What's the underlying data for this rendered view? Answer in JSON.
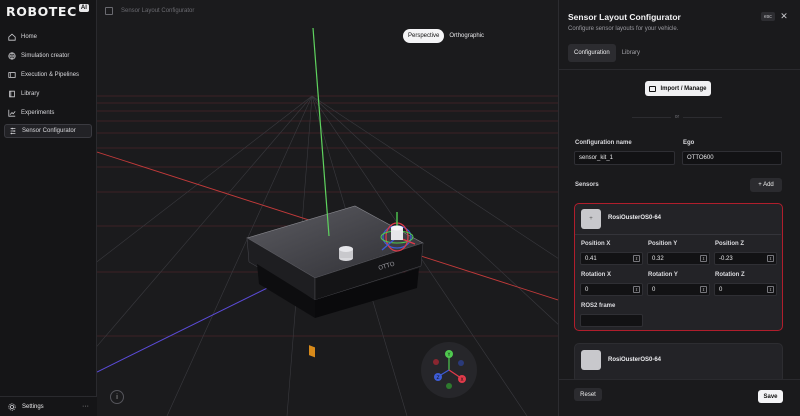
{
  "app": {
    "logo_text": "ROBOTEC",
    "logo_badge": "AI"
  },
  "sidebar": {
    "items": [
      {
        "label": "Home",
        "icon": "home-icon"
      },
      {
        "label": "Simulation creator",
        "icon": "globe-icon"
      },
      {
        "label": "Execution & Pipelines",
        "icon": "layers-icon"
      },
      {
        "label": "Library",
        "icon": "book-icon"
      },
      {
        "label": "Experiments",
        "icon": "chart-icon"
      },
      {
        "label": "Sensor Configurator",
        "icon": "",
        "active": true
      }
    ],
    "settings_label": "Settings",
    "settings_more": "···"
  },
  "viewport": {
    "title": "Sensor Layout Configurator",
    "view_modes": [
      "Perspective",
      "Orthographic"
    ],
    "active_view": "Perspective",
    "robot_label": "OTTO",
    "gizmo_axes": {
      "y": "Y",
      "x": "X",
      "z": "Z"
    },
    "info_label": "i",
    "colors": {
      "grid_red": "#c23a3a",
      "x_axis": "#e03a4a",
      "y_axis": "#4fc94f",
      "z_axis": "#3d5cd6"
    }
  },
  "panel": {
    "title": "Sensor Layout Configurator",
    "subtitle": "Configure sensor layouts for your vehicle.",
    "esc_label": "esc",
    "close_label": "✕",
    "tabs": [
      "Configuration",
      "Library"
    ],
    "active_tab": "Configuration",
    "import_label": "Import / Manage",
    "or_label": "or",
    "config_name_label": "Configuration name",
    "config_name_value": "sensor_kit_1",
    "ego_label": "Ego",
    "ego_value": "OTTO600",
    "sensors_label": "Sensors",
    "add_label": "+ Add",
    "sensors": [
      {
        "name": "RosiOusterOS0-64",
        "thumb": "+",
        "fields": {
          "pos_x": {
            "label": "Position X",
            "value": "0.41"
          },
          "pos_y": {
            "label": "Position Y",
            "value": "0.32"
          },
          "pos_z": {
            "label": "Position Z",
            "value": "-0.23"
          },
          "rot_x": {
            "label": "Rotation X",
            "value": "0"
          },
          "rot_y": {
            "label": "Rotation Y",
            "value": "0"
          },
          "rot_z": {
            "label": "Rotation Z",
            "value": "0"
          },
          "ros2_frame": {
            "label": "ROS2 frame",
            "value": ""
          }
        },
        "spin_glyph": "⇕"
      },
      {
        "name": "RosiOusterOS0-64",
        "thumb": ""
      }
    ],
    "reset_label": "Reset",
    "save_label": "Save",
    "accent_color": "#b01e2c"
  }
}
